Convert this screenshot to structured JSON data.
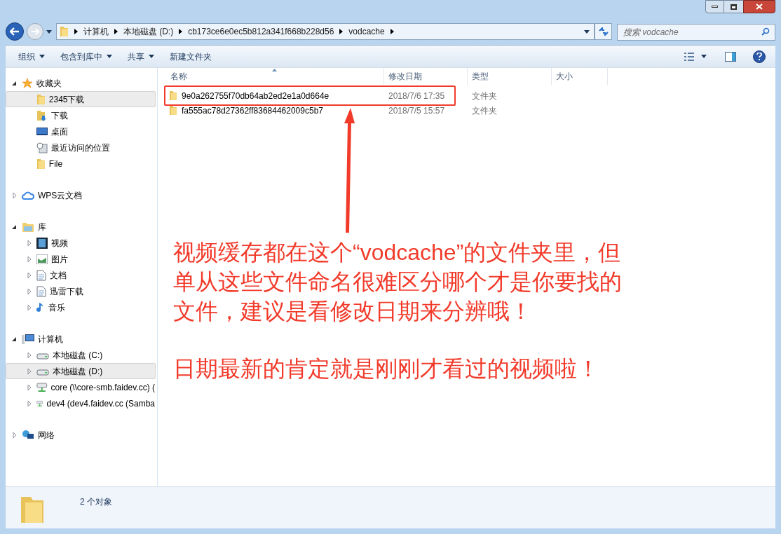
{
  "address_bar": {
    "crumbs": [
      "计算机",
      "本地磁盘 (D:)",
      "cb173ce6e0ec5b812a341f668b228d56",
      "vodcache"
    ]
  },
  "search": {
    "placeholder": "搜索 vodcache"
  },
  "toolbar": {
    "buttons": [
      {
        "label": "组织",
        "dropdown": true
      },
      {
        "label": "包含到库中",
        "dropdown": true
      },
      {
        "label": "共享",
        "dropdown": true
      },
      {
        "label": "新建文件夹",
        "dropdown": false
      }
    ]
  },
  "sidebar": {
    "groups": [
      {
        "label": "收藏夹",
        "kind": "star",
        "expanded": true,
        "children": [
          {
            "label": "2345下载",
            "kind": "folder",
            "selected": true
          },
          {
            "label": "下载",
            "kind": "download",
            "selected": false
          },
          {
            "label": "桌面",
            "kind": "desktop",
            "selected": false
          },
          {
            "label": "最近访问的位置",
            "kind": "recent",
            "selected": false
          },
          {
            "label": "File",
            "kind": "folder",
            "selected": false
          }
        ]
      },
      {
        "label": "WPS云文档",
        "kind": "cloud",
        "expanded": false
      },
      {
        "label": "库",
        "kind": "library",
        "expanded": true,
        "children": [
          {
            "label": "视频",
            "kind": "video",
            "expanded": false,
            "selected": false
          },
          {
            "label": "图片",
            "kind": "picture",
            "expanded": false,
            "selected": false
          },
          {
            "label": "文档",
            "kind": "document",
            "expanded": false,
            "selected": false
          },
          {
            "label": "迅雷下载",
            "kind": "document",
            "expanded": false,
            "selected": false
          },
          {
            "label": "音乐",
            "kind": "music",
            "expanded": false,
            "selected": false
          }
        ]
      },
      {
        "label": "计算机",
        "kind": "computer",
        "expanded": true,
        "children": [
          {
            "label": "本地磁盘 (C:)",
            "kind": "drive",
            "expanded": false,
            "selected": false
          },
          {
            "label": "本地磁盘 (D:)",
            "kind": "drive",
            "expanded": false,
            "selected": true
          },
          {
            "label": "core (\\\\core-smb.faidev.cc) (",
            "kind": "netdrive",
            "expanded": false,
            "selected": false
          },
          {
            "label": "dev4 (dev4.faidev.cc (Samba",
            "kind": "netdrive",
            "expanded": false,
            "selected": false
          }
        ]
      },
      {
        "label": "网络",
        "kind": "network",
        "expanded": false
      }
    ]
  },
  "table": {
    "columns": [
      "名称",
      "修改日期",
      "类型",
      "大小"
    ],
    "rows": [
      {
        "name": "9e0a262755f70db64ab2ed2e1a0d664e",
        "modified": "2018/7/6 17:35",
        "type": "文件夹"
      },
      {
        "name": "fa555ac78d27362ff83684462009c5b7",
        "modified": "2018/7/5 15:57",
        "type": "文件夹"
      }
    ]
  },
  "annotation": {
    "paragraphs": [
      "视频缓存都在这个“vodcache”的文件夹里，但单从这些文件命名很难区分哪个才是你要找的文件，建议是看修改日期来分辨哦！",
      "日期最新的肯定就是刚刚才看过的视频啦！"
    ]
  },
  "status_bar": {
    "text": "2 个对象"
  }
}
